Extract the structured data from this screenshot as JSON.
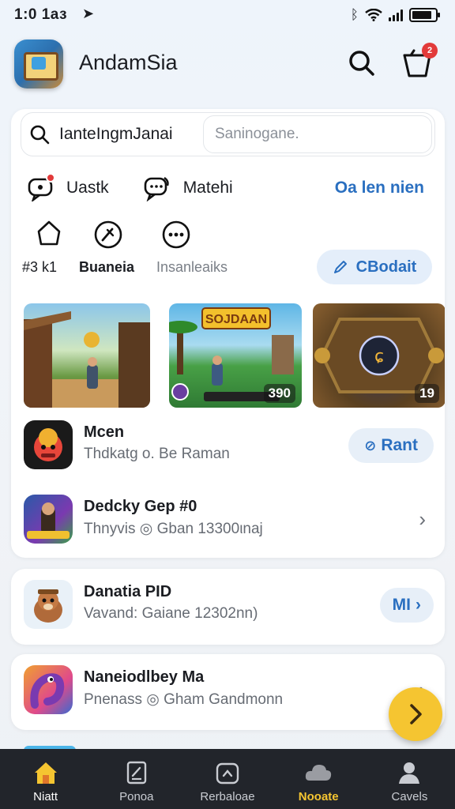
{
  "status_bar": {
    "time": "1:0 1аз",
    "icons": [
      "location-arrow-icon",
      "bluetooth-icon",
      "wifi-icon",
      "signal-icon",
      "battery-icon"
    ]
  },
  "header": {
    "app_title": "AndamSia",
    "cart_badge": "2",
    "icons": [
      "search-icon",
      "cart-icon"
    ]
  },
  "search": {
    "left_text": "IanteIngmJanai",
    "right_placeholder": "Saninogane."
  },
  "actions": {
    "item1_label": "Uastk",
    "item2_label": "Matehi",
    "link_label": "Oa len nien"
  },
  "quick_icons": {
    "item1_label": "#3 k1",
    "item2_label": "Buaneia",
    "item3_label": "Insanleaiks",
    "button_label": "CBodait"
  },
  "thumbnails": [
    {
      "badge": "",
      "title": ""
    },
    {
      "badge": "390",
      "title": "SOJDAAN"
    },
    {
      "badge": "19",
      "title": ""
    }
  ],
  "list": [
    {
      "title": "Mcen",
      "subtitle": "Thdkatg o. Be Raman",
      "button": "Rant",
      "button_icon": "sync-icon"
    },
    {
      "title": "Dedcky Gep #0",
      "subtitle": "Thnyvis ◎ Gban 13300ιnaj",
      "action": "chevron"
    }
  ],
  "cards": [
    {
      "title": "Danatia PID",
      "subtitle": "Vavand: Gaiane 12302nn)",
      "button": "MI"
    },
    {
      "title": "Naneiodlbey Ma",
      "subtitle": "Pnenass ◎ Gham Gandmonn",
      "action": "chevron"
    }
  ],
  "bottom_nav": [
    {
      "label": "Niatt",
      "icon": "home-icon"
    },
    {
      "label": "Ponoa",
      "icon": "edit-icon"
    },
    {
      "label": "Rerbaloae",
      "icon": "camera-icon"
    },
    {
      "label": "Nooate",
      "icon": "cloud-icon"
    },
    {
      "label": "Cavels",
      "icon": "profile-icon"
    }
  ],
  "colors": {
    "accent_blue": "#2a6fc0",
    "badge_red": "#e23a3a",
    "fab_yellow": "#f5c531",
    "nav_bg": "#22252b"
  }
}
